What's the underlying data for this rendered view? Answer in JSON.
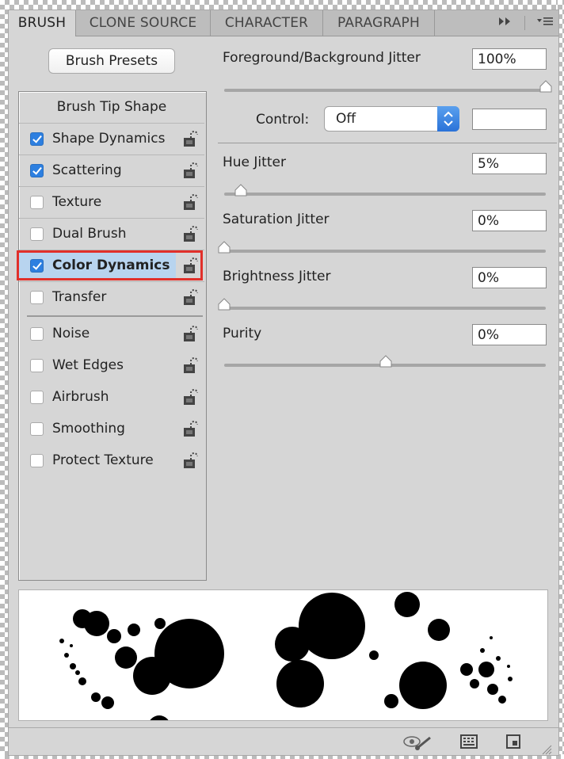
{
  "tabs": [
    {
      "label": "BRUSH",
      "active": true
    },
    {
      "label": "CLONE SOURCE",
      "active": false
    },
    {
      "label": "CHARACTER",
      "active": false
    },
    {
      "label": "PARAGRAPH",
      "active": false
    }
  ],
  "tab_icons": [
    "fast-forward-icon",
    "panel-menu-icon"
  ],
  "presets_button": "Brush Presets",
  "list": {
    "header": "Brush Tip Shape",
    "items": [
      {
        "label": "Shape Dynamics",
        "checked": true
      },
      {
        "label": "Scattering",
        "checked": true
      },
      {
        "label": "Texture",
        "checked": false
      },
      {
        "label": "Dual Brush",
        "checked": false
      },
      {
        "label": "Color Dynamics",
        "checked": true,
        "selected": true
      },
      {
        "label": "Transfer",
        "checked": false
      },
      {
        "label": "Noise",
        "checked": false
      },
      {
        "label": "Wet Edges",
        "checked": false
      },
      {
        "label": "Airbrush",
        "checked": false
      },
      {
        "label": "Smoothing",
        "checked": false
      },
      {
        "label": "Protect Texture",
        "checked": false
      }
    ]
  },
  "settings": {
    "fg_bg_jitter": {
      "label": "Foreground/Background Jitter",
      "value": "100%",
      "slider": 1.0
    },
    "control": {
      "label": "Control:",
      "value": "Off",
      "extra_value": ""
    },
    "hue_jitter": {
      "label": "Hue Jitter",
      "value": "5%",
      "slider": 0.05
    },
    "saturation_jitter": {
      "label": "Saturation Jitter",
      "value": "0%",
      "slider": 0.0
    },
    "brightness_jitter": {
      "label": "Brightness Jitter",
      "value": "0%",
      "slider": 0.0
    },
    "purity": {
      "label": "Purity",
      "value": "0%",
      "slider": 0.5
    }
  },
  "bottom_icons": [
    "eye-brush-icon",
    "grid-panel-icon",
    "new-preset-icon"
  ],
  "colors": {
    "accent": "#2d7fe0",
    "selection": "#b8d4ef",
    "highlight_box": "#e1302a"
  }
}
